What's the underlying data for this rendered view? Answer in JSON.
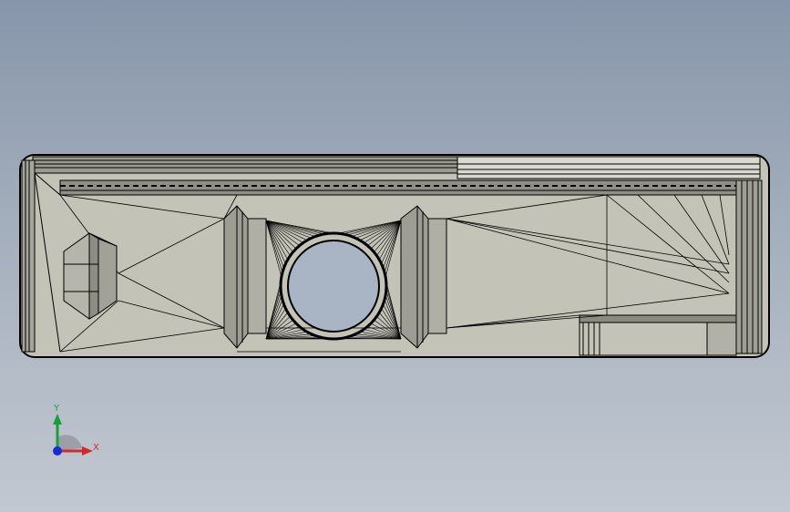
{
  "viewport": {
    "background_top": "#8796aa",
    "background_bottom": "#c2c8d1"
  },
  "model": {
    "description_icon": "cad-part-wireframe",
    "face_color": "#c4c3b8",
    "edge_color": "#000000",
    "hole_color": "#a9b4c4"
  },
  "triad": {
    "y_label": "Y",
    "x_label": "X",
    "y_color": "#1a9e3a",
    "x_color": "#d12a2a",
    "z_color": "#1a2ad1"
  }
}
